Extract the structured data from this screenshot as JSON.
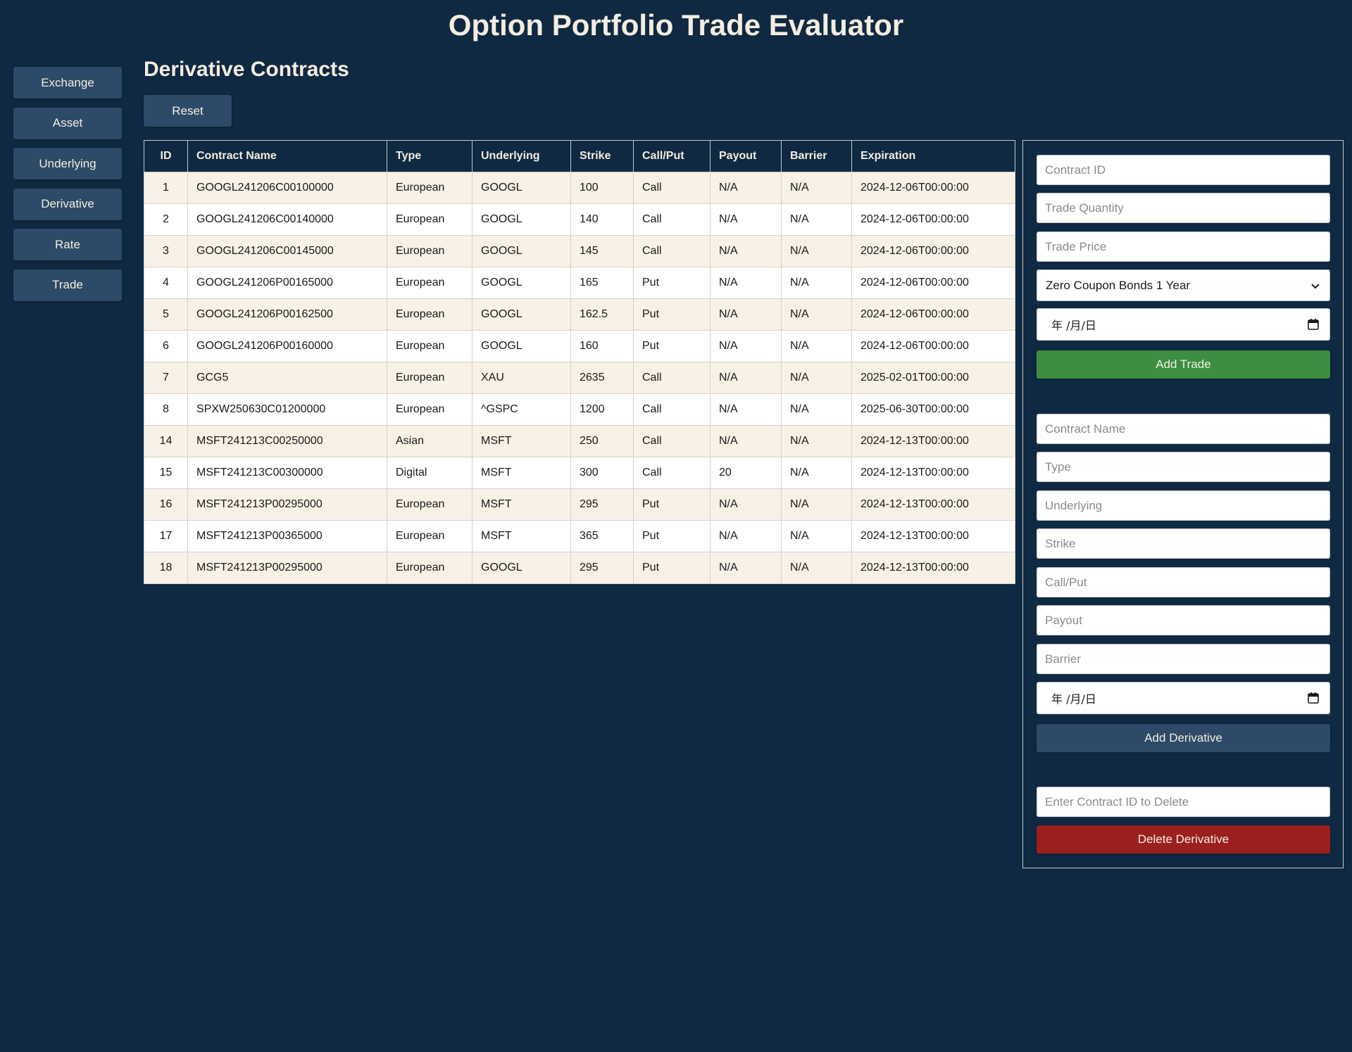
{
  "app": {
    "title": "Option Portfolio Trade Evaluator"
  },
  "sidebar": {
    "items": [
      {
        "label": "Exchange"
      },
      {
        "label": "Asset"
      },
      {
        "label": "Underlying"
      },
      {
        "label": "Derivative"
      },
      {
        "label": "Rate"
      },
      {
        "label": "Trade"
      }
    ]
  },
  "main": {
    "section_title": "Derivative Contracts",
    "reset_label": "Reset"
  },
  "table": {
    "columns": [
      "ID",
      "Contract Name",
      "Type",
      "Underlying",
      "Strike",
      "Call/Put",
      "Payout",
      "Barrier",
      "Expiration"
    ],
    "rows": [
      [
        "1",
        "GOOGL241206C00100000",
        "European",
        "GOOGL",
        "100",
        "Call",
        "N/A",
        "N/A",
        "2024-12-06T00:00:00"
      ],
      [
        "2",
        "GOOGL241206C00140000",
        "European",
        "GOOGL",
        "140",
        "Call",
        "N/A",
        "N/A",
        "2024-12-06T00:00:00"
      ],
      [
        "3",
        "GOOGL241206C00145000",
        "European",
        "GOOGL",
        "145",
        "Call",
        "N/A",
        "N/A",
        "2024-12-06T00:00:00"
      ],
      [
        "4",
        "GOOGL241206P00165000",
        "European",
        "GOOGL",
        "165",
        "Put",
        "N/A",
        "N/A",
        "2024-12-06T00:00:00"
      ],
      [
        "5",
        "GOOGL241206P00162500",
        "European",
        "GOOGL",
        "162.5",
        "Put",
        "N/A",
        "N/A",
        "2024-12-06T00:00:00"
      ],
      [
        "6",
        "GOOGL241206P00160000",
        "European",
        "GOOGL",
        "160",
        "Put",
        "N/A",
        "N/A",
        "2024-12-06T00:00:00"
      ],
      [
        "7",
        "GCG5",
        "European",
        "XAU",
        "2635",
        "Call",
        "N/A",
        "N/A",
        "2025-02-01T00:00:00"
      ],
      [
        "8",
        "SPXW250630C01200000",
        "European",
        "^GSPC",
        "1200",
        "Call",
        "N/A",
        "N/A",
        "2025-06-30T00:00:00"
      ],
      [
        "14",
        "MSFT241213C00250000",
        "Asian",
        "MSFT",
        "250",
        "Call",
        "N/A",
        "N/A",
        "2024-12-13T00:00:00"
      ],
      [
        "15",
        "MSFT241213C00300000",
        "Digital",
        "MSFT",
        "300",
        "Call",
        "20",
        "N/A",
        "2024-12-13T00:00:00"
      ],
      [
        "16",
        "MSFT241213P00295000",
        "European",
        "MSFT",
        "295",
        "Put",
        "N/A",
        "N/A",
        "2024-12-13T00:00:00"
      ],
      [
        "17",
        "MSFT241213P00365000",
        "European",
        "MSFT",
        "365",
        "Put",
        "N/A",
        "N/A",
        "2024-12-13T00:00:00"
      ],
      [
        "18",
        "MSFT241213P00295000",
        "European",
        "GOOGL",
        "295",
        "Put",
        "N/A",
        "N/A",
        "2024-12-13T00:00:00"
      ]
    ]
  },
  "trade_form": {
    "contract_id_placeholder": "Contract ID",
    "quantity_placeholder": "Trade Quantity",
    "price_placeholder": "Trade Price",
    "rate_selected": "Zero Coupon Bonds 1 Year",
    "date_placeholder": "年 /月/日",
    "add_label": "Add Trade"
  },
  "derivative_form": {
    "name_placeholder": "Contract Name",
    "type_placeholder": "Type",
    "underlying_placeholder": "Underlying",
    "strike_placeholder": "Strike",
    "callput_placeholder": "Call/Put",
    "payout_placeholder": "Payout",
    "barrier_placeholder": "Barrier",
    "date_placeholder": "年 /月/日",
    "add_label": "Add Derivative"
  },
  "delete_form": {
    "id_placeholder": "Enter Contract ID to Delete",
    "delete_label": "Delete Derivative"
  },
  "colors": {
    "background": "#0f2942",
    "button": "#2d4a68",
    "add_trade": "#3e8e41",
    "delete": "#9b1f1f",
    "row_alt": "#f7f1e6"
  }
}
